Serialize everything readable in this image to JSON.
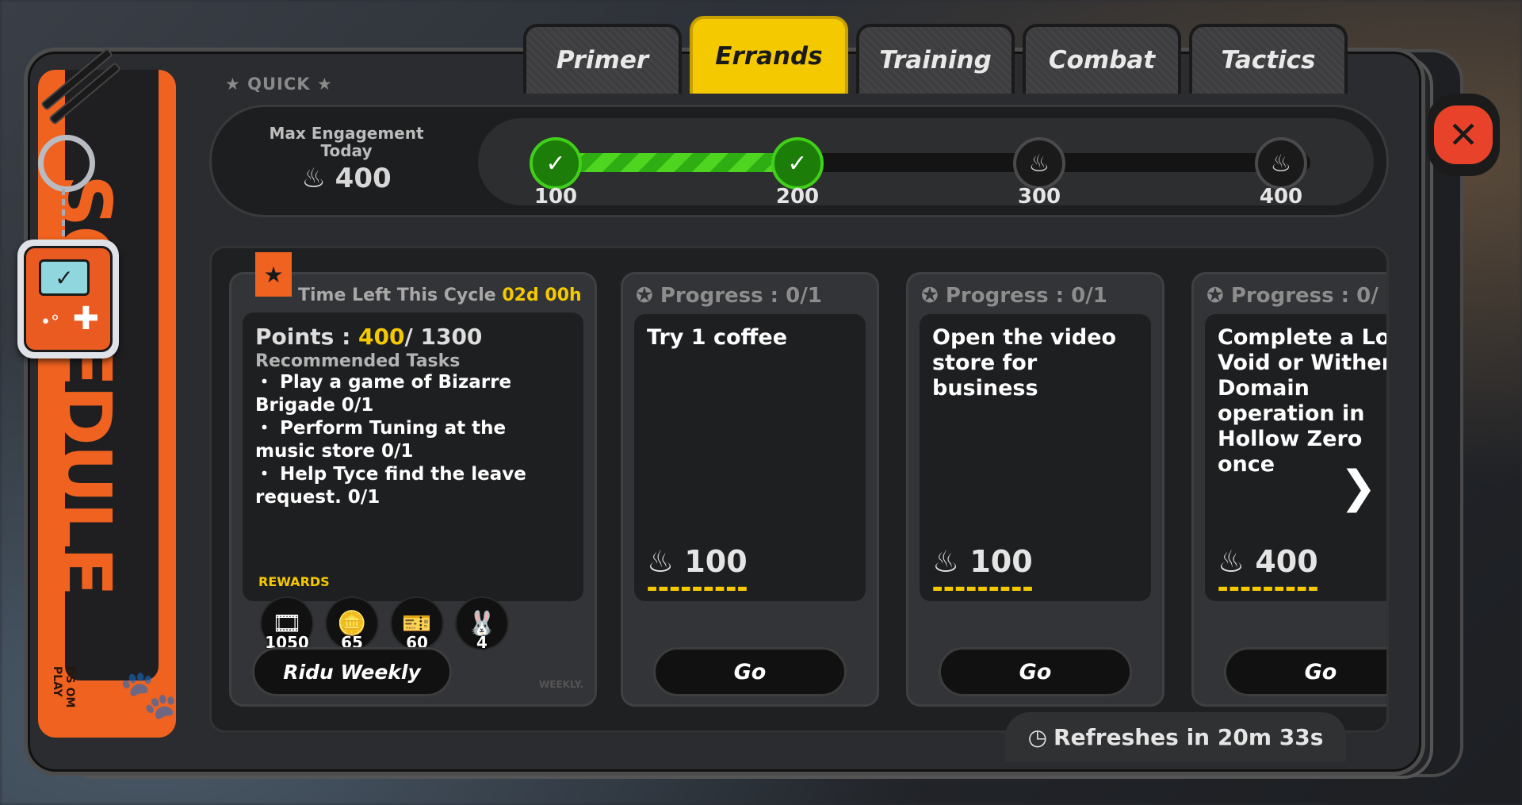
{
  "tabs": [
    {
      "label": "Primer",
      "active": false
    },
    {
      "label": "Errands",
      "active": true
    },
    {
      "label": "Training",
      "active": false
    },
    {
      "label": "Combat",
      "active": false
    },
    {
      "label": "Tactics",
      "active": false
    }
  ],
  "quick_label": "★ QUICK ★",
  "side_title": "SCHEDULE",
  "side_subtitle": "DS OM PLAY",
  "engagement": {
    "label_line1": "Max Engagement",
    "label_line2": "Today",
    "value": "400",
    "progress": 200,
    "milestones": [
      {
        "value": "100",
        "reached": true
      },
      {
        "value": "200",
        "reached": true
      },
      {
        "value": "300",
        "reached": false
      },
      {
        "value": "400",
        "reached": false
      }
    ]
  },
  "weekly": {
    "time_left_label": "Time Left This Cycle",
    "time_left_value": "02d 00h",
    "points_label": "Points :",
    "points_current": "400",
    "points_total": "/ 1300",
    "recommended_title": "Recommended Tasks",
    "tasks": [
      "・ Play a game of Bizarre Brigade 0/1",
      "・ Perform Tuning at the music store 0/1",
      "・ Help Tyce find the leave request. 0/1"
    ],
    "rewards_label": "REWARDS",
    "rewards": [
      {
        "icon": "film-icon",
        "qty": "1050"
      },
      {
        "icon": "coin-stack-icon",
        "qty": "65"
      },
      {
        "icon": "ticket-icon",
        "qty": "60"
      },
      {
        "icon": "bangboo-icon",
        "qty": "4"
      }
    ],
    "button_label": "Ridu Weekly",
    "tag": "WEEKLY."
  },
  "task_cards": [
    {
      "progress": "Progress : 0/1",
      "text": "Try 1 coffee",
      "points": "100",
      "button": "Go"
    },
    {
      "progress": "Progress : 0/1",
      "text": "Open the video store for business",
      "points": "100",
      "button": "Go"
    },
    {
      "progress": "Progress : 0/",
      "text": "Complete a Lost Void or Withered Domain operation in Hollow Zero once",
      "points": "400",
      "button": "Go"
    }
  ],
  "refresh_text": "Refreshes in 20m 33s",
  "close_label": "✕",
  "next_arrow": "❯"
}
